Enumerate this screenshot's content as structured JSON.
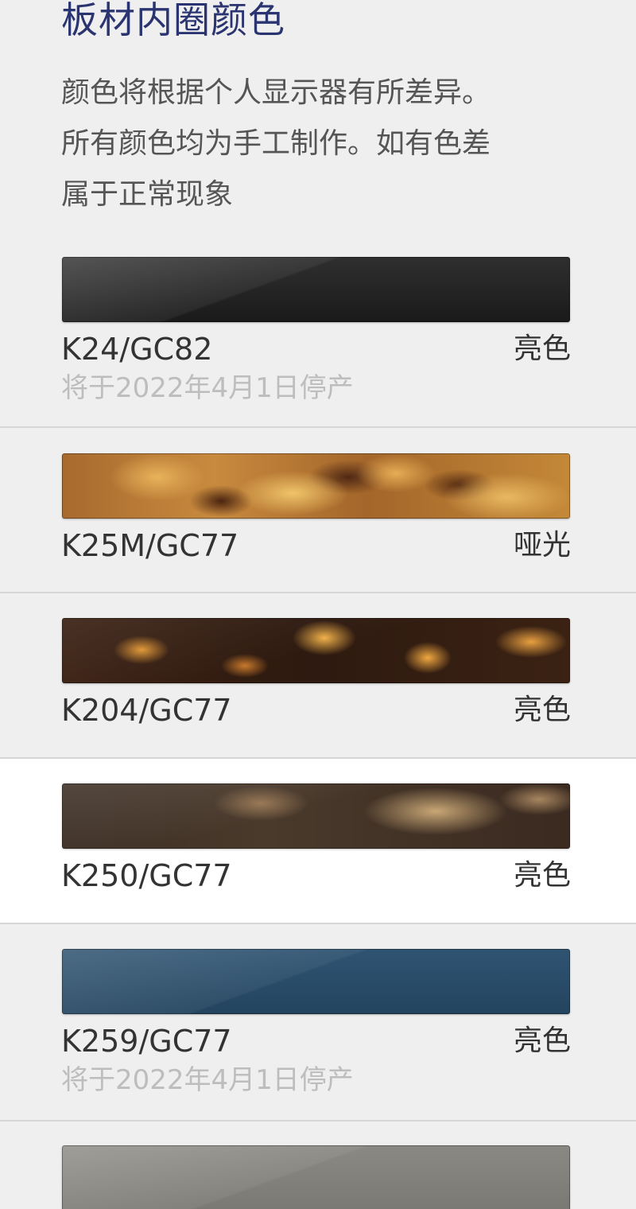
{
  "header": {
    "title": "板材内圈颜色",
    "disclaimer_lines": [
      "颜色将根据个人显示器有所差异。",
      "所有颜色均为手工制作。如有色差",
      "属于正常现象"
    ]
  },
  "colors": {
    "title": "#2a3470",
    "text": "#333333",
    "note": "#bdbdbd",
    "background": "#efefef",
    "selected_background": "#ffffff"
  },
  "options": [
    {
      "code": "K24/GC82",
      "finish": "亮色",
      "note": "将于2022年4月1日停产",
      "swatch": "black-glossy",
      "selected": false
    },
    {
      "code": "K25M/GC77",
      "finish": "哑光",
      "note": "",
      "swatch": "tortoise-matte",
      "selected": false
    },
    {
      "code": "K204/GC77",
      "finish": "亮色",
      "note": "",
      "swatch": "dark-tortoise-glossy",
      "selected": false
    },
    {
      "code": "K250/GC77",
      "finish": "亮色",
      "note": "",
      "swatch": "brown-horn-glossy",
      "selected": true
    },
    {
      "code": "K259/GC77",
      "finish": "亮色",
      "note": "将于2022年4月1日停产",
      "swatch": "blue-glossy",
      "selected": false
    },
    {
      "code": "",
      "finish": "",
      "note": "",
      "swatch": "grey-glossy",
      "selected": false
    }
  ]
}
